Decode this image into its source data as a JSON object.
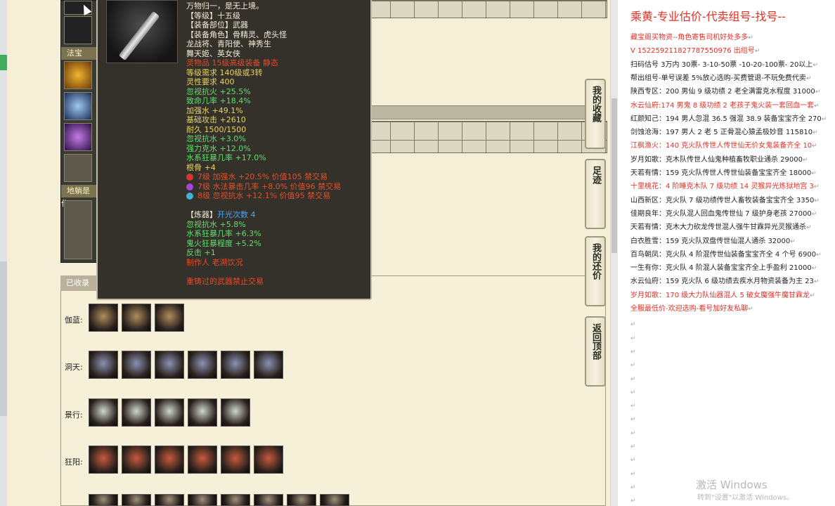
{
  "sidebar": {
    "labels": {
      "fabao": "法宝",
      "dipan": "地躺是作"
    }
  },
  "tooltip": {
    "lines": [
      {
        "text": "万物归一，是无上境。",
        "color": "w"
      },
      {
        "text": "【等级】十五级",
        "color": "w"
      },
      {
        "text": "【装备部位】武器",
        "color": "w"
      },
      {
        "text": "【装备角色】骨精灵、虎头怪",
        "color": "w"
      },
      {
        "text": "龙战将、青阳使、神秀生",
        "color": "w"
      },
      {
        "text": "舞天姬、英女侠",
        "color": "w"
      },
      {
        "text": "灵物品 15级高级装备 静态",
        "color": "r"
      },
      {
        "text": "等级需求 140级或3转",
        "color": "y"
      },
      {
        "text": "灵性要求 400",
        "color": "y"
      },
      {
        "text": "忽视抗火 +25.5%",
        "color": "g1"
      },
      {
        "text": "致命几率 +18.4%",
        "color": "g1"
      },
      {
        "text": "加强水 +49.1%",
        "color": "y"
      },
      {
        "text": "基础攻击 +2610",
        "color": "y"
      },
      {
        "text": "耐久 1500/1500",
        "color": "y"
      },
      {
        "text": "忽视抗水 +3.0%",
        "color": "g1"
      },
      {
        "text": "强力克水 +12.0%",
        "color": "g1"
      },
      {
        "text": "水系狂暴几率 +17.0%",
        "color": "g1"
      },
      {
        "text": "根骨 +4",
        "color": "y"
      }
    ],
    "gems": [
      {
        "text": "7级 加强水 +20.5% 价值105 禁交易",
        "color": "#d8362a"
      },
      {
        "text": "7级 水法暴击几率 +8.0% 价值96 禁交易",
        "color": "#a446d9"
      },
      {
        "text": "8级 忽视抗水 +12.1% 价值95 禁交易",
        "color": "#3fb0d8"
      }
    ],
    "lian_prefix": "【炼器】",
    "lian_count": "开光次数 4",
    "lian_lines": [
      {
        "text": "忽视抗水 +5.8%",
        "color": "g1"
      },
      {
        "text": "水系狂暴几率 +6.3%",
        "color": "g1"
      },
      {
        "text": "鬼火狂暴程度 +5.2%",
        "color": "g1"
      },
      {
        "text": "反击 +1",
        "color": "g1"
      },
      {
        "text": "制作人 老溯饮况",
        "color": "r"
      }
    ],
    "footer": "重铸过的武器禁止交易"
  },
  "collection": {
    "title": "已收录",
    "rows": [
      {
        "label": "伽蓝:",
        "count": 3
      },
      {
        "label": "洞天:",
        "count": 6
      },
      {
        "label": "景行:",
        "count": 5
      },
      {
        "label": "狂阳:",
        "count": 6
      },
      {
        "label": "",
        "count": 8
      }
    ]
  },
  "nav_buttons": [
    {
      "label": "我的收藏"
    },
    {
      "label": "足迹"
    },
    {
      "label": "我的还价"
    },
    {
      "label": "返回顶部"
    }
  ],
  "doc": {
    "title": "乘黄-专业估价-代卖组号-找号--",
    "lines": [
      {
        "text": "藏宝阁买物资--角色寄售司机好处多多",
        "red": true
      },
      {
        "text": "V 152259211827787550976 出组号",
        "red": true
      },
      {
        "text": "扫码估号 3万内 30票- 3-10-50票 -10-20-100票- 20以上",
        "red": false
      },
      {
        "text": "帮出组号-单号误差 5%放心选购-买费管退-不玩免费代卖",
        "red": false
      },
      {
        "text": "陕西专区：200 男仙 9 级功绩 2 老全满雷克水程度 31000",
        "red": false
      },
      {
        "text": "水云仙府:174 男鬼 8 级功绩 2 老孩子鬼火装一套回血一套",
        "red": true
      },
      {
        "text": "红颜知己：194 男人忽混 36.5 强混 38.9 装备宝宝齐全 270",
        "red": false
      },
      {
        "text": "剑蚀沧海：197 男人 2 老 5 正骨混心猿孟极妙音 115810",
        "red": false
      },
      {
        "text": "江枫渔火：140 克火队传世人传世仙无价女鬼装备齐全 10",
        "red": true
      },
      {
        "text": "岁月如歌：克木队传世人仙鬼种植畜牧职业通杀 29000",
        "red": false
      },
      {
        "text": "天若有情：159 克火队传世人传世仙装备宝宝齐全 18000",
        "red": false
      },
      {
        "text": "十里桃花：4 阶睡克木队 7 级功绩 14 灵猴异光炼狱地宫 3",
        "red": true
      },
      {
        "text": "山西新区：克火队 7 级功绩传世人畜牧装备宝宝齐全 3350",
        "red": false
      },
      {
        "text": "佳期良年：克火队混人回血鬼传世仙 7 级护身老孩 27000",
        "red": false
      },
      {
        "text": "天若有情：克木大力砍龙传世混人强牛甘霖异光灵猴通杀",
        "red": false
      },
      {
        "text": "白衣胜雪：159 克火队双盘传世仙混人通杀 32000",
        "red": false
      },
      {
        "text": "百鸟朝凤：克火队 4 阶混传世仙装备宝宝齐全 4 个号 6900",
        "red": false
      },
      {
        "text": "一生有你：克火队 4 阶混人装备宝宝齐全上手盈利 21000",
        "red": false
      },
      {
        "text": "水云仙府：159 克火队 6 级功绩去疾水月物资装备为主 23",
        "red": false
      },
      {
        "text": "岁月如歌：170 级大力队仙器混人 5 破女魔强牛魔甘霖龙",
        "red": true
      },
      {
        "text": "全服最低价-欢迎选购-看号加好友私聊",
        "red": true
      }
    ],
    "empty_mark": "↵"
  },
  "watermark": {
    "line1": "激活 Windows",
    "line2": "转到\"设置\"以激活 Windows。"
  }
}
